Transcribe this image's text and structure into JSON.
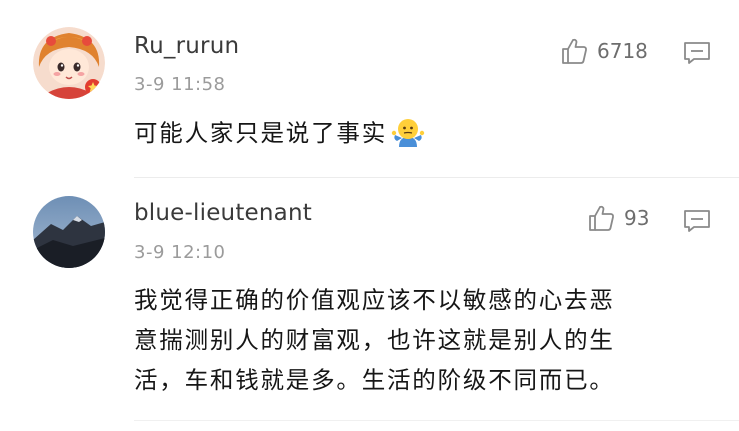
{
  "comments": [
    {
      "username": "Ru_rurun",
      "timestamp": "3-9 11:58",
      "likes": "6718",
      "text": "可能人家只是说了事实",
      "emoji": "shrug-emoji",
      "avatar": "anime-girl-avatar"
    },
    {
      "username": "blue-lieutenant",
      "timestamp": "3-9 12:10",
      "likes": "93",
      "text_lines": [
        "我觉得正确的价值观应该不以敏感的心去恶",
        "意揣测别人的财富观，也许这就是别人的生",
        "活，车和钱就是多。生活的阶级不同而已。"
      ],
      "avatar": "mountain-photo-avatar"
    }
  ],
  "icons": {
    "like": "thumbs-up-icon",
    "reply": "comment-icon"
  },
  "colors": {
    "username": "#3a3a3a",
    "timestamp": "#9b9b9b",
    "count": "#6d6d6d",
    "text": "#161616",
    "divider": "#ececec"
  }
}
